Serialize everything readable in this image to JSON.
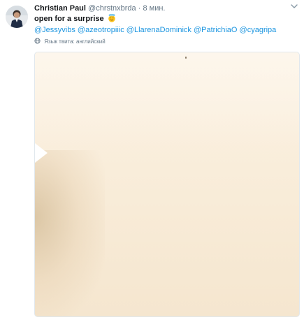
{
  "tweet": {
    "display_name": "Christian Paul",
    "handle": "@chrstnxbrda",
    "separator": "·",
    "timestamp": "8 мин.",
    "text": "open for a surprise",
    "emoji": "smiling-face-with-halo",
    "mentions": [
      "@Jessyvibs",
      "@azeotropiiic",
      "@LlarenaDominick",
      "@PatrichiaO",
      "@cyagripa"
    ],
    "language_note": "Язык твита: английский"
  },
  "colors": {
    "link": "#1b95e0",
    "secondary_text": "#657786",
    "primary_text": "#14171a",
    "media_background": "#f9edda"
  },
  "icons": {
    "caret": "chevron-down-icon",
    "globe": "globe-icon",
    "avatar": "avatar"
  }
}
